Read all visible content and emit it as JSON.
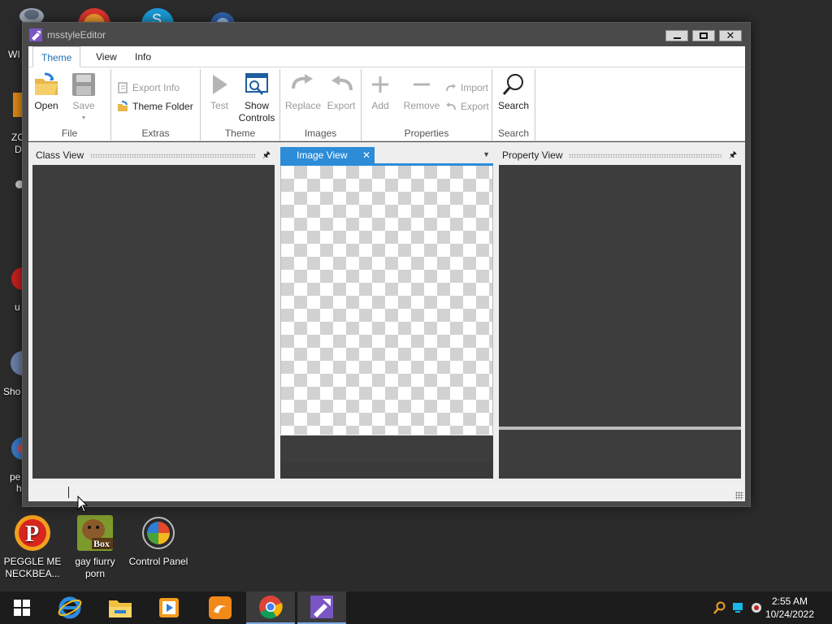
{
  "window": {
    "title": "msstyleEditor",
    "minimize_icon": "minimize-icon",
    "maximize_icon": "maximize-icon",
    "close_icon": "close-icon"
  },
  "ribbon_tabs": [
    {
      "label": "Theme",
      "active": true
    },
    {
      "label": "View",
      "active": false
    },
    {
      "label": "Info",
      "active": false
    }
  ],
  "groups": {
    "file": {
      "label": "File",
      "open": "Open",
      "save": "Save"
    },
    "extras": {
      "label": "Extras",
      "export_info": "Export Info",
      "theme_folder": "Theme Folder"
    },
    "theme": {
      "label": "Theme",
      "test": "Test",
      "show_controls_1": "Show",
      "show_controls_2": "Controls"
    },
    "images": {
      "label": "Images",
      "replace": "Replace",
      "export": "Export"
    },
    "properties": {
      "label": "Properties",
      "add": "Add",
      "remove": "Remove",
      "import": "Import",
      "export": "Export"
    },
    "search": {
      "label": "Search",
      "search": "Search"
    }
  },
  "panels": {
    "class_view": "Class View",
    "image_view": "Image View",
    "property_view": "Property View"
  },
  "desktop_icons": [
    {
      "label_1": "PEGGLE ME",
      "label_2": "NECKBEA...",
      "icon": "peggle-icon"
    },
    {
      "label_1": "gay fiurry",
      "label_2": "porn",
      "icon": "box-icon",
      "badge": "Box"
    },
    {
      "label_1": "Control Panel",
      "label_2": "",
      "icon": "control-panel-icon"
    }
  ],
  "partial_labels": {
    "wi": "WI",
    "zo": "ZO",
    "d": "D",
    "u": "u",
    "sho": "Sho",
    "pe": "pe",
    "h": "h"
  },
  "clock": {
    "time": "2:55 AM",
    "date": "10/24/2022"
  },
  "colors": {
    "accent": "#2c8cd8",
    "ribbon_active_tab": "#1e6fb8"
  }
}
